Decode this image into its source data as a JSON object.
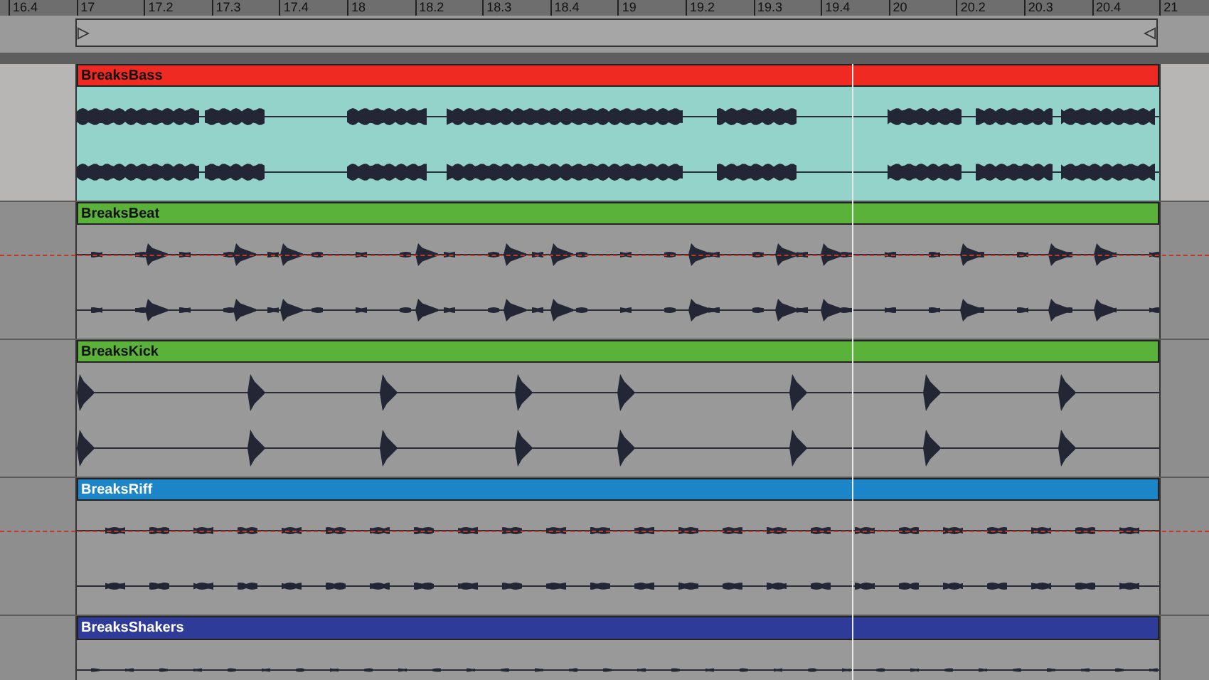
{
  "ruler": {
    "labels": [
      "16.4",
      "17",
      "17.2",
      "17.3",
      "17.4",
      "18",
      "18.2",
      "18.3",
      "18.4",
      "19",
      "19.2",
      "19.3",
      "19.4",
      "20",
      "20.2",
      "20.3",
      "20.4",
      "21"
    ]
  },
  "tracks": [
    {
      "name": "BreaksBass",
      "color": "#ee2a22",
      "kind": "bass",
      "automation": false
    },
    {
      "name": "BreaksBeat",
      "color": "#5bb23a",
      "kind": "beat",
      "automation": true
    },
    {
      "name": "BreaksKick",
      "color": "#5bb23a",
      "kind": "kick",
      "automation": false
    },
    {
      "name": "BreaksRiff",
      "color": "#1b85c8",
      "kind": "riff",
      "automation": true
    },
    {
      "name": "BreaksShakers",
      "color": "#2f3b99",
      "kind": "shakers",
      "automation": false
    }
  ]
}
